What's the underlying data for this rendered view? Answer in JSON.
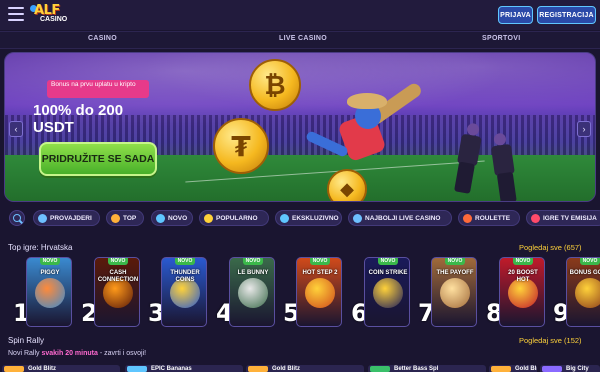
{
  "header": {
    "logo_text": "ALF",
    "logo_subtext": "CASINO",
    "login_label": "PRIJAVA",
    "register_label": "REGISTRACIJA"
  },
  "nav": {
    "casino": "CASINO",
    "live_casino": "LIVE CASINO",
    "sport": "SPORTOVI"
  },
  "banner": {
    "tag": "Bonus na prvu uplatu u kripto",
    "headline": "100% do 200 USDT",
    "cta": "PRIDRUŽITE SE SADA",
    "prev_arrow": "‹",
    "next_arrow": "›"
  },
  "categories": [
    {
      "label": "PROVAJDERI",
      "color": "#6ec0ff"
    },
    {
      "label": "TOP",
      "color": "#ffb13a"
    },
    {
      "label": "NOVO",
      "color": "#5fc6ff"
    },
    {
      "label": "POPULARNO",
      "color": "#ffd23a"
    },
    {
      "label": "EKSKLUZIVNO",
      "color": "#5fc6ff"
    },
    {
      "label": "NAJBOLJI LIVE CASINO",
      "color": "#6ec0ff"
    },
    {
      "label": "ROULETTE",
      "color": "#ff6a3a"
    },
    {
      "label": "IGRE TV EMISIJA",
      "color": "#ff4a6a"
    }
  ],
  "top_games": {
    "title": "Top igre: Hrvatska",
    "see_all": "Pogledaj sve (657)",
    "badge": "NOVO",
    "items": [
      {
        "rank": "1",
        "name": "PIGGY",
        "bg": "#3a8ad0",
        "accent": "#ff8a3a"
      },
      {
        "rank": "2",
        "name": "CASH CONNECTION",
        "bg": "#5a1a0a",
        "accent": "#ff9a1a"
      },
      {
        "rank": "3",
        "name": "THUNDER COINS",
        "bg": "#2a5ad0",
        "accent": "#ffd23a"
      },
      {
        "rank": "4",
        "name": "LE BUNNY",
        "bg": "#3a6a4a",
        "accent": "#e8e8e8"
      },
      {
        "rank": "5",
        "name": "HOT STEP 2",
        "bg": "#d04a1a",
        "accent": "#ffd23a"
      },
      {
        "rank": "6",
        "name": "COIN STRIKE",
        "bg": "#1a1a5a",
        "accent": "#ffd23a"
      },
      {
        "rank": "7",
        "name": "THE PAYOFF",
        "bg": "#a06a3a",
        "accent": "#ffe0a0"
      },
      {
        "rank": "8",
        "name": "20 BOOST HOT",
        "bg": "#c01a2a",
        "accent": "#ffd23a"
      },
      {
        "rank": "9",
        "name": "BONUS GOLD",
        "bg": "#8a3a1a",
        "accent": "#ffd23a"
      }
    ]
  },
  "spin_rally": {
    "title": "Spin Rally",
    "see_all": "Pogledaj sve (152)",
    "subtitle_before": "Novi Rally ",
    "subtitle_highlight": "svakih 20 minuta",
    "subtitle_after": " - zavrti i osvoji!",
    "cards": [
      {
        "name": "Gold Blitz",
        "color": "#ffb13a"
      },
      {
        "name": "EPIC Bananas",
        "color": "#5fc6ff"
      },
      {
        "name": "Gold Blitz",
        "color": "#ffb13a"
      },
      {
        "name": "Better Bass Spl",
        "color": "#3ac06a"
      },
      {
        "name": "Gold Blitz",
        "color": "#ffb13a"
      },
      {
        "name": "Big City",
        "color": "#8a6aff"
      }
    ]
  }
}
